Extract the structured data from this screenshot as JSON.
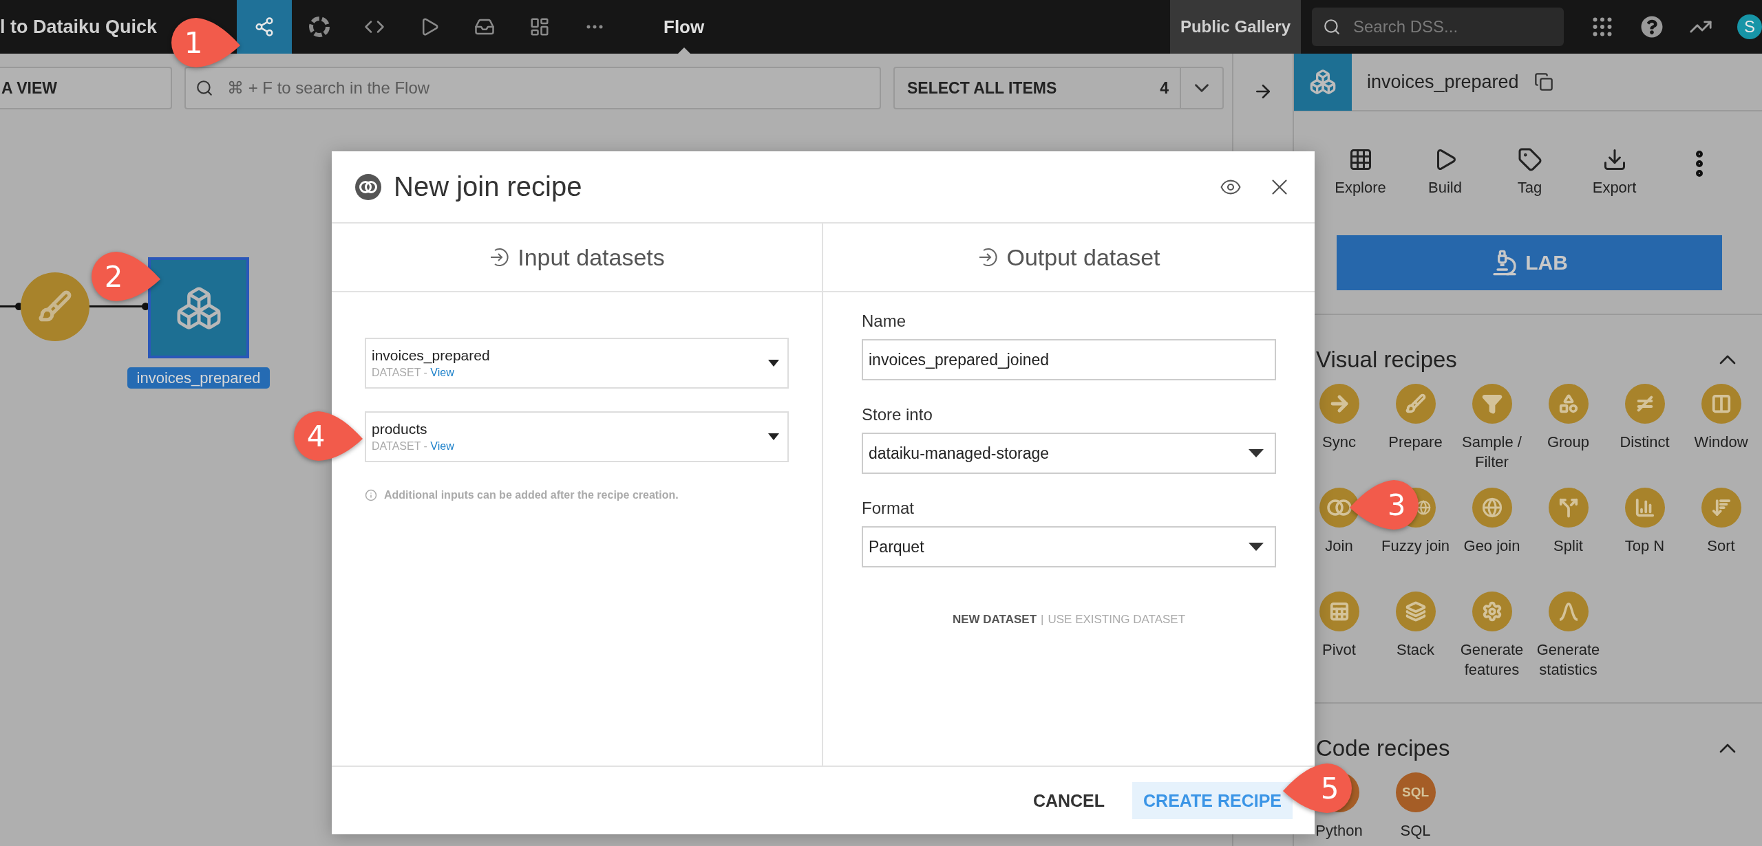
{
  "top_bar": {
    "project_title": "l to Dataiku Quick",
    "nav": [
      {
        "selected": true
      },
      {
        "selected": false
      },
      {
        "selected": false
      },
      {
        "selected": false
      },
      {
        "selected": false
      },
      {
        "selected": false
      },
      {
        "selected": false
      }
    ],
    "section": "Flow",
    "gallery_link": "Public Gallery",
    "search": {
      "placeholder": "Search DSS..."
    },
    "avatar": "S"
  },
  "flow_toolbar": {
    "view_button": "A VIEW",
    "search": {
      "placeholder": "⌘ + F to search in the Flow"
    },
    "select_all": {
      "label": "SELECT ALL ITEMS",
      "count": "4"
    }
  },
  "flow": {
    "dataset": {
      "name": "invoices_prepared",
      "selected": true
    }
  },
  "right_panel": {
    "dataset_name": "invoices_prepared",
    "actions": [
      "Explore",
      "Build",
      "Tag",
      "Export"
    ],
    "lab_button": "LAB",
    "sections": [
      {
        "title": "Visual recipes",
        "expanded": true,
        "items": [
          {
            "label": "Sync"
          },
          {
            "label": "Prepare"
          },
          {
            "label": "Sample / Filter"
          },
          {
            "label": "Group"
          },
          {
            "label": "Distinct"
          },
          {
            "label": "Window"
          },
          {
            "label": "Join"
          },
          {
            "label": "Fuzzy join"
          },
          {
            "label": "Geo join"
          },
          {
            "label": "Split"
          },
          {
            "label": "Top N"
          },
          {
            "label": "Sort"
          },
          {
            "label": "Pivot"
          },
          {
            "label": "Stack"
          },
          {
            "label": "Generate features"
          },
          {
            "label": "Generate statistics"
          }
        ]
      },
      {
        "title": "Code recipes",
        "expanded": true,
        "items": [
          {
            "label": "Python"
          },
          {
            "label": "SQL",
            "icon_text": "SQL"
          }
        ]
      }
    ]
  },
  "modal": {
    "title": "New join recipe",
    "input_header": "Input datasets",
    "inputs": [
      {
        "name": "invoices_prepared",
        "type": "DATASET",
        "separator": "-",
        "link": "View"
      },
      {
        "name": "products",
        "type": "DATASET",
        "separator": "-",
        "link": "View"
      }
    ],
    "note": "Additional inputs can be added after the recipe creation.",
    "output_header": "Output dataset",
    "fields": [
      {
        "kind": "text",
        "label": "Name",
        "value": "invoices_prepared_joined"
      },
      {
        "kind": "select",
        "label": "Store into",
        "value": "dataiku-managed-storage"
      },
      {
        "kind": "select",
        "label": "Format",
        "value": "Parquet"
      }
    ],
    "mode_options": [
      {
        "label": "NEW DATASET",
        "selected": true
      },
      {
        "label": "USE EXISTING DATASET",
        "selected": false
      }
    ],
    "mode_separator": "|",
    "buttons": [
      {
        "label": "CANCEL",
        "kind": "secondary"
      },
      {
        "label": "CREATE RECIPE",
        "kind": "primary"
      }
    ]
  },
  "callouts": [
    {
      "label": "1"
    },
    {
      "label": "2"
    },
    {
      "label": "3"
    },
    {
      "label": "4"
    },
    {
      "label": "5"
    }
  ]
}
